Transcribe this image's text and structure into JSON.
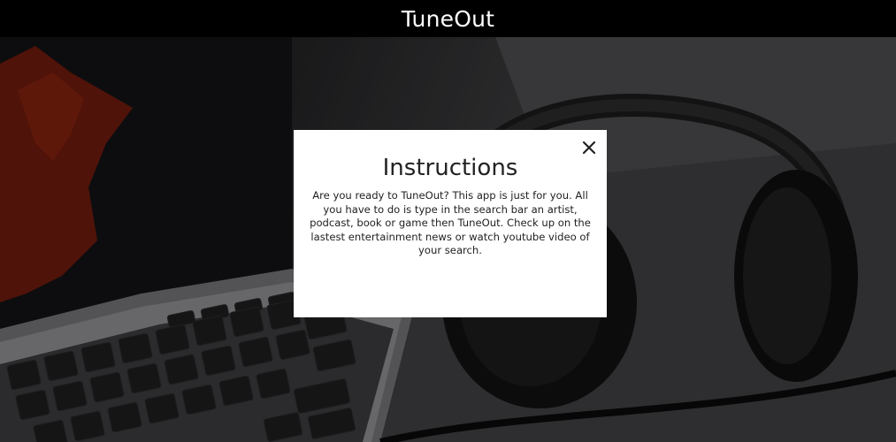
{
  "app": {
    "title": "TuneOut"
  },
  "hero": {
    "icon": "background-laptop-headphones-image"
  },
  "modal": {
    "title": "Instructions",
    "body": "Are you ready to TuneOut? This app is just for you. All you have to do is type in the search bar an artist, podcast, book or game then TuneOut. Check up on the lastest entertainment news or watch youtube video of your search.",
    "close_icon": "close-icon"
  }
}
